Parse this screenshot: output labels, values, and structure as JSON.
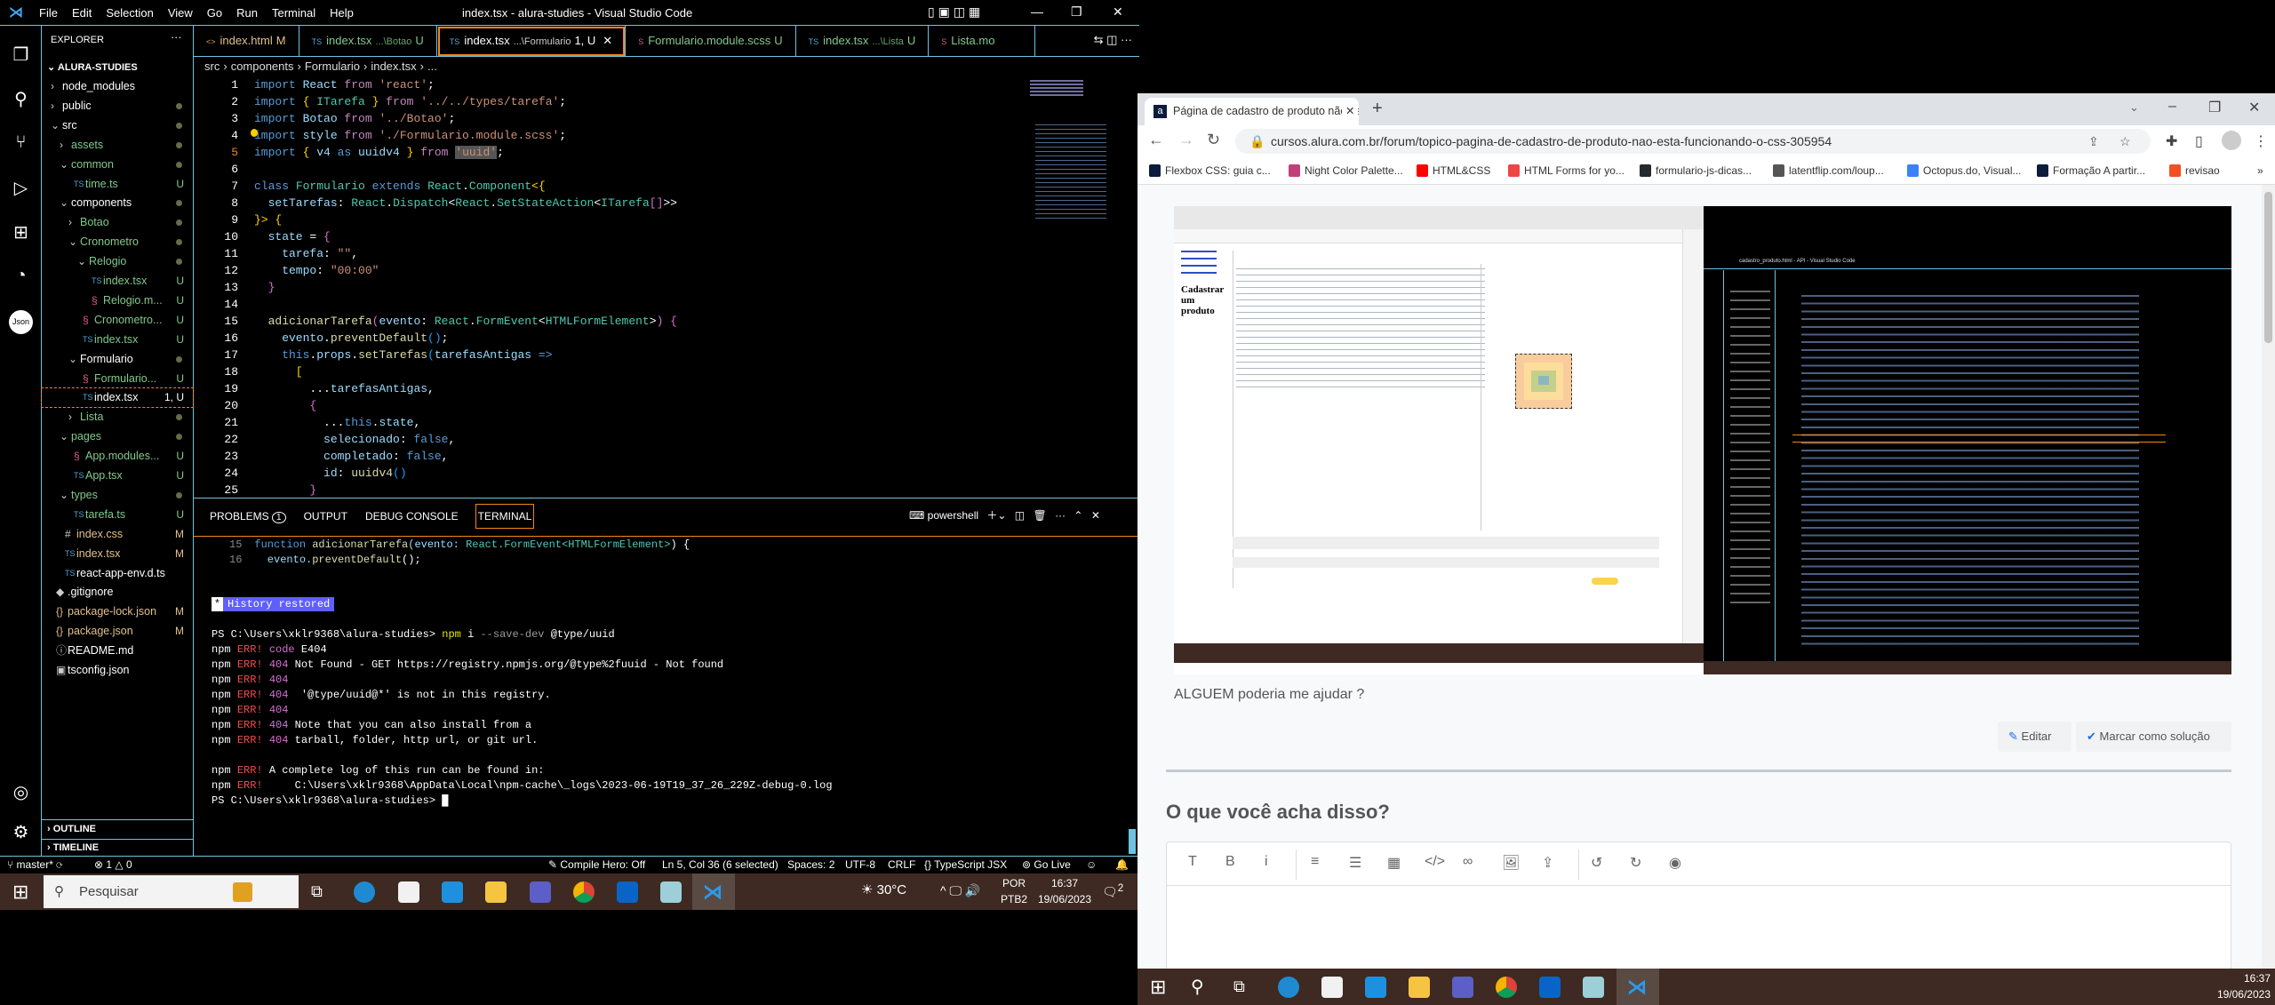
{
  "vscode": {
    "menu": [
      "File",
      "Edit",
      "Selection",
      "View",
      "Go",
      "Run",
      "Terminal",
      "Help"
    ],
    "title": "index.tsx - alura-studies - Visual Studio Code",
    "explorer_title": "EXPLORER",
    "project": "ALURA-STUDIES",
    "tree": [
      {
        "label": "node_modules",
        "depth": 1,
        "type": "folder-closed",
        "status": "",
        "color": "#ffffff"
      },
      {
        "label": "public",
        "depth": 1,
        "type": "folder-closed",
        "status": "dot",
        "color": "#ffffff"
      },
      {
        "label": "src",
        "depth": 1,
        "type": "folder-open",
        "status": "dot",
        "color": "#ffffff"
      },
      {
        "label": "assets",
        "depth": 2,
        "type": "folder-closed",
        "status": "dot",
        "color": "#81c88b"
      },
      {
        "label": "common",
        "depth": 2,
        "type": "folder-open",
        "status": "dot",
        "color": "#81c88b"
      },
      {
        "label": "time.ts",
        "depth": 3,
        "type": "ts",
        "status": "U",
        "color": "#81c88b"
      },
      {
        "label": "components",
        "depth": 2,
        "type": "folder-open",
        "status": "dot",
        "color": "#ffffff"
      },
      {
        "label": "Botao",
        "depth": 3,
        "type": "folder-closed",
        "status": "dot",
        "color": "#81c88b"
      },
      {
        "label": "Cronometro",
        "depth": 3,
        "type": "folder-open",
        "status": "dot",
        "color": "#81c88b"
      },
      {
        "label": "Relogio",
        "depth": 4,
        "type": "folder-open",
        "status": "dot",
        "color": "#81c88b"
      },
      {
        "label": "index.tsx",
        "depth": 5,
        "type": "ts",
        "status": "U",
        "color": "#81c88b"
      },
      {
        "label": "Relogio.m...",
        "depth": 5,
        "type": "scss",
        "status": "U",
        "color": "#81c88b"
      },
      {
        "label": "Cronometro...",
        "depth": 4,
        "type": "scss",
        "status": "U",
        "color": "#81c88b"
      },
      {
        "label": "index.tsx",
        "depth": 4,
        "type": "ts",
        "status": "U",
        "color": "#81c88b"
      },
      {
        "label": "Formulario",
        "depth": 3,
        "type": "folder-open",
        "status": "dot",
        "color": "#ffffff"
      },
      {
        "label": "Formulario...",
        "depth": 4,
        "type": "scss",
        "status": "U",
        "color": "#81c88b"
      },
      {
        "label": "index.tsx",
        "depth": 4,
        "type": "ts",
        "status": "1, U",
        "color": "#ffffff",
        "selected": true
      },
      {
        "label": "Lista",
        "depth": 3,
        "type": "folder-closed",
        "status": "dot",
        "color": "#81c88b"
      },
      {
        "label": "pages",
        "depth": 2,
        "type": "folder-open",
        "status": "dot",
        "color": "#81c88b"
      },
      {
        "label": "App.modules...",
        "depth": 3,
        "type": "scss",
        "status": "U",
        "color": "#81c88b"
      },
      {
        "label": "App.tsx",
        "depth": 3,
        "type": "ts",
        "status": "U",
        "color": "#81c88b"
      },
      {
        "label": "types",
        "depth": 2,
        "type": "folder-open",
        "status": "dot",
        "color": "#81c88b"
      },
      {
        "label": "tarefa.ts",
        "depth": 3,
        "type": "ts",
        "status": "U",
        "color": "#81c88b"
      },
      {
        "label": "index.css",
        "depth": 2,
        "type": "css",
        "status": "M",
        "color": "#e2c08d"
      },
      {
        "label": "index.tsx",
        "depth": 2,
        "type": "ts",
        "status": "M",
        "color": "#e2c08d"
      },
      {
        "label": "react-app-env.d.ts",
        "depth": 2,
        "type": "ts",
        "status": "",
        "color": "#ffffff"
      },
      {
        "label": ".gitignore",
        "depth": 1,
        "type": "git",
        "status": "",
        "color": "#ffffff"
      },
      {
        "label": "package-lock.json",
        "depth": 1,
        "type": "json",
        "status": "M",
        "color": "#e2c08d"
      },
      {
        "label": "package.json",
        "depth": 1,
        "type": "json",
        "status": "M",
        "color": "#e2c08d"
      },
      {
        "label": "README.md",
        "depth": 1,
        "type": "info",
        "status": "",
        "color": "#ffffff"
      },
      {
        "label": "tsconfig.json",
        "depth": 1,
        "type": "tsconfig",
        "status": "",
        "color": "#ffffff"
      }
    ],
    "outline": "OUTLINE",
    "timeline": "TIMELINE",
    "tabs": [
      {
        "icon": "<>",
        "label": "index.html",
        "hint": "",
        "status": "M",
        "color": "#e2c08d"
      },
      {
        "icon": "TS",
        "label": "index.tsx",
        "hint": "...\\Botao",
        "status": "U",
        "color": "#81c88b"
      },
      {
        "icon": "TS",
        "label": "index.tsx",
        "hint": "...\\Formulario",
        "status": "1, U",
        "color": "#ffffff",
        "active": true
      },
      {
        "icon": "S",
        "label": "Formulario.module.scss",
        "hint": "",
        "status": "U",
        "color": "#81c88b"
      },
      {
        "icon": "TS",
        "label": "index.tsx",
        "hint": "...\\Lista",
        "status": "U",
        "color": "#81c88b"
      },
      {
        "icon": "S",
        "label": "Lista.mo",
        "hint": "",
        "status": "",
        "color": "#81c88b"
      }
    ],
    "breadcrumb": [
      "src",
      "components",
      "Formulario",
      "index.tsx",
      "..."
    ],
    "code": [
      [
        [
          "import ",
          "kw"
        ],
        [
          "React ",
          "var"
        ],
        [
          "from ",
          "kw2"
        ],
        [
          "'react'",
          "str"
        ],
        [
          ";",
          "pl"
        ]
      ],
      [
        [
          "import ",
          "kw"
        ],
        [
          "{ ",
          "br1"
        ],
        [
          "ITarefa ",
          "ty"
        ],
        [
          "} ",
          "br1"
        ],
        [
          "from ",
          "kw2"
        ],
        [
          "'../../types/tarefa'",
          "str"
        ],
        [
          ";",
          "pl"
        ]
      ],
      [
        [
          "import ",
          "kw"
        ],
        [
          "Botao ",
          "var"
        ],
        [
          "from ",
          "kw2"
        ],
        [
          "'../Botao'",
          "str"
        ],
        [
          ";",
          "pl"
        ]
      ],
      [
        [
          "import ",
          "kw"
        ],
        [
          "style ",
          "var"
        ],
        [
          "from ",
          "kw2"
        ],
        [
          "'./Formulario.module.scss'",
          "str"
        ],
        [
          ";",
          "pl"
        ]
      ],
      [
        [
          "import ",
          "kw"
        ],
        [
          "{ ",
          "br1"
        ],
        [
          "v4 ",
          "var"
        ],
        [
          "as ",
          "kw"
        ],
        [
          "uuidv4 ",
          "var"
        ],
        [
          "} ",
          "br1"
        ],
        [
          "from ",
          "kw2"
        ],
        [
          "'uuid'",
          "str"
        ],
        [
          ";",
          "pl"
        ]
      ],
      [],
      [
        [
          "class ",
          "kw"
        ],
        [
          "Formulario ",
          "ty"
        ],
        [
          "extends ",
          "kw"
        ],
        [
          "React",
          "ty"
        ],
        [
          ".",
          "pl"
        ],
        [
          "Component",
          "ty"
        ],
        [
          "<{",
          "br1"
        ]
      ],
      [
        [
          "  setTarefas",
          "var"
        ],
        [
          ": ",
          "pl"
        ],
        [
          "React",
          "ty"
        ],
        [
          ".",
          "pl"
        ],
        [
          "Dispatch",
          "ty"
        ],
        [
          "<",
          "pl"
        ],
        [
          "React",
          "ty"
        ],
        [
          ".",
          "pl"
        ],
        [
          "SetStateAction",
          "ty"
        ],
        [
          "<",
          "pl"
        ],
        [
          "ITarefa",
          "ty"
        ],
        [
          "[]",
          "br2"
        ],
        [
          ">>",
          "pl"
        ]
      ],
      [
        [
          "}>",
          "br1"
        ],
        [
          " {",
          "br1"
        ]
      ],
      [
        [
          "  state ",
          "var"
        ],
        [
          "= ",
          "pl"
        ],
        [
          "{",
          "br2"
        ]
      ],
      [
        [
          "    tarefa",
          "var"
        ],
        [
          ": ",
          "pl"
        ],
        [
          "\"\"",
          "str"
        ],
        [
          ",",
          "pl"
        ]
      ],
      [
        [
          "    tempo",
          "var"
        ],
        [
          ": ",
          "pl"
        ],
        [
          "\"00:00\"",
          "str"
        ]
      ],
      [
        [
          "  }",
          "br2"
        ]
      ],
      [],
      [
        [
          "  adicionarTarefa",
          "fn"
        ],
        [
          "(",
          "br2"
        ],
        [
          "evento",
          "var"
        ],
        [
          ": ",
          "pl"
        ],
        [
          "React",
          "ty"
        ],
        [
          ".",
          "pl"
        ],
        [
          "FormEvent",
          "ty"
        ],
        [
          "<",
          "pl"
        ],
        [
          "HTMLFormElement",
          "ty"
        ],
        [
          ">",
          "pl"
        ],
        [
          ")",
          "br2"
        ],
        [
          " {",
          "br2"
        ]
      ],
      [
        [
          "    evento",
          "var"
        ],
        [
          ".",
          "pl"
        ],
        [
          "preventDefault",
          "fn"
        ],
        [
          "()",
          "br3"
        ],
        [
          ";",
          "pl"
        ]
      ],
      [
        [
          "    this",
          "kw"
        ],
        [
          ".",
          "pl"
        ],
        [
          "props",
          "var"
        ],
        [
          ".",
          "pl"
        ],
        [
          "setTarefas",
          "fn"
        ],
        [
          "(",
          "br3"
        ],
        [
          "tarefasAntigas ",
          "var"
        ],
        [
          "=>",
          "kw"
        ]
      ],
      [
        [
          "      [",
          "br1"
        ]
      ],
      [
        [
          "        ...",
          "pl"
        ],
        [
          "tarefasAntigas",
          "var"
        ],
        [
          ",",
          "pl"
        ]
      ],
      [
        [
          "        {",
          "br2"
        ]
      ],
      [
        [
          "          ...",
          "pl"
        ],
        [
          "this",
          "kw"
        ],
        [
          ".",
          "pl"
        ],
        [
          "state",
          "var"
        ],
        [
          ",",
          "pl"
        ]
      ],
      [
        [
          "          selecionado",
          "var"
        ],
        [
          ": ",
          "pl"
        ],
        [
          "false",
          "kw"
        ],
        [
          ",",
          "pl"
        ]
      ],
      [
        [
          "          completado",
          "var"
        ],
        [
          ": ",
          "pl"
        ],
        [
          "false",
          "kw"
        ],
        [
          ",",
          "pl"
        ]
      ],
      [
        [
          "          id",
          "var"
        ],
        [
          ": ",
          "pl"
        ],
        [
          "uuidv4",
          "fn"
        ],
        [
          "()",
          "br3"
        ]
      ],
      [
        [
          "        }",
          "br2"
        ]
      ]
    ],
    "panel": {
      "tabs": [
        "PROBLEMS",
        "OUTPUT",
        "DEBUG CONSOLE",
        "TERMINAL"
      ],
      "problems_count": "1",
      "shell": "powershell",
      "preview": [
        {
          "num": "15",
          "tokens": [
            [
              "function ",
              "kw"
            ],
            [
              "adicionarTarefa",
              "fn"
            ],
            [
              "(evento: ",
              "var"
            ],
            [
              "React.FormEvent<HTMLFormElement>",
              "ty"
            ],
            [
              ") {",
              "pl"
            ]
          ]
        },
        {
          "num": "16",
          "tokens": [
            [
              "  evento.",
              "var"
            ],
            [
              "preventDefault",
              "fn"
            ],
            [
              "();",
              "pl"
            ]
          ]
        }
      ],
      "history": "History restored",
      "terminal": [
        [
          [
            "PS C:\\Users\\xklr9368\\alura-studies> ",
            "pl"
          ],
          [
            "npm ",
            "yel"
          ],
          [
            "i ",
            "pl"
          ],
          [
            "--save-dev ",
            "gry"
          ],
          [
            "@type/uuid",
            "pl"
          ]
        ],
        [
          [
            "npm ",
            "pl"
          ],
          [
            "ERR! ",
            "red"
          ],
          [
            "code ",
            "mag"
          ],
          [
            "E404",
            "pl"
          ]
        ],
        [
          [
            "npm ",
            "pl"
          ],
          [
            "ERR! ",
            "red"
          ],
          [
            "404 ",
            "mag"
          ],
          [
            "Not Found - GET https://registry.npmjs.org/@type%2fuuid - Not found",
            "pl"
          ]
        ],
        [
          [
            "npm ",
            "pl"
          ],
          [
            "ERR! ",
            "red"
          ],
          [
            "404",
            "mag"
          ]
        ],
        [
          [
            "npm ",
            "pl"
          ],
          [
            "ERR! ",
            "red"
          ],
          [
            "404 ",
            "mag"
          ],
          [
            " '@type/uuid@*' is not in this registry.",
            "pl"
          ]
        ],
        [
          [
            "npm ",
            "pl"
          ],
          [
            "ERR! ",
            "red"
          ],
          [
            "404",
            "mag"
          ]
        ],
        [
          [
            "npm ",
            "pl"
          ],
          [
            "ERR! ",
            "red"
          ],
          [
            "404 ",
            "mag"
          ],
          [
            "Note that you can also install from a",
            "pl"
          ]
        ],
        [
          [
            "npm ",
            "pl"
          ],
          [
            "ERR! ",
            "red"
          ],
          [
            "404 ",
            "mag"
          ],
          [
            "tarball, folder, http url, or git url.",
            "pl"
          ]
        ],
        [],
        [
          [
            "npm ",
            "pl"
          ],
          [
            "ERR! ",
            "red"
          ],
          [
            "A complete log of this run can be found in:",
            "pl"
          ]
        ],
        [
          [
            "npm ",
            "pl"
          ],
          [
            "ERR! ",
            "red"
          ],
          [
            "    C:\\Users\\xklr9368\\AppData\\Local\\npm-cache\\_logs\\2023-06-19T19_37_26_229Z-debug-0.log",
            "pl"
          ]
        ],
        [
          [
            "PS C:\\Users\\xklr9368\\alura-studies> ",
            "pl"
          ],
          [
            "█",
            "pl"
          ]
        ]
      ]
    },
    "status": {
      "branch": "master*",
      "errors": "1",
      "warnings": "0",
      "compile_hero": "Compile Hero: Off",
      "position": "Ln 5, Col 36 (6 selected)",
      "spaces": "Spaces: 2",
      "encoding": "UTF-8",
      "eol": "CRLF",
      "language": "TypeScript JSX",
      "golive": "Go Live"
    }
  },
  "taskbar_left": {
    "search_placeholder": "Pesquisar",
    "weather": "30°C",
    "lang1": "POR",
    "lang2": "PTB2",
    "time": "16:37",
    "date": "19/06/2023",
    "notifications": "2"
  },
  "chrome": {
    "tab_title": "Página de cadastro de produto não está funcionando o css",
    "url": "cursos.alura.com.br/forum/topico-pagina-de-cadastro-de-produto-nao-esta-funcionando-o-css-305954",
    "bookmarks": [
      {
        "label": "Flexbox CSS: guia c...",
        "color": "#0b1d3a"
      },
      {
        "label": "Night Color Palette...",
        "color": "#c0407a"
      },
      {
        "label": "HTML&CSS",
        "color": "#ff0000"
      },
      {
        "label": "HTML Forms for yo...",
        "color": "#ef4444"
      },
      {
        "label": "formulario-js-dicas...",
        "color": "#24292f"
      },
      {
        "label": "latentflip.com/loup...",
        "color": "#555555"
      },
      {
        "label": "Octopus.do, Visual...",
        "color": "#3b82f6"
      },
      {
        "label": "Formação A partir...",
        "color": "#0b1d3a"
      },
      {
        "label": "revisao",
        "color": "#f25022"
      }
    ],
    "more": "»"
  },
  "forum": {
    "screenshot": {
      "page_heading": "Cadastrar um produto",
      "vscode_title": "cadastro_produto.html - API - Visual Studio Code"
    },
    "post_text": "ALGUEM poderia me ajudar ?",
    "edit_label": "Editar",
    "solution_label": "Marcar como solução",
    "reply_title": "O que você acha disso?",
    "editor_tools": [
      "T",
      "B",
      "i",
      "≡",
      "☰",
      "▦",
      "</>",
      "∞",
      "🖼",
      "⇪",
      "↺",
      "↻",
      "◉"
    ]
  },
  "taskbar_right": {
    "time": "16:37",
    "date": "19/06/2023"
  },
  "colors": {
    "accent_border": "#6fc3df",
    "active_border": "#f38518",
    "taskbar": "#3e2a22",
    "link_blue": "#1c6ee8"
  }
}
